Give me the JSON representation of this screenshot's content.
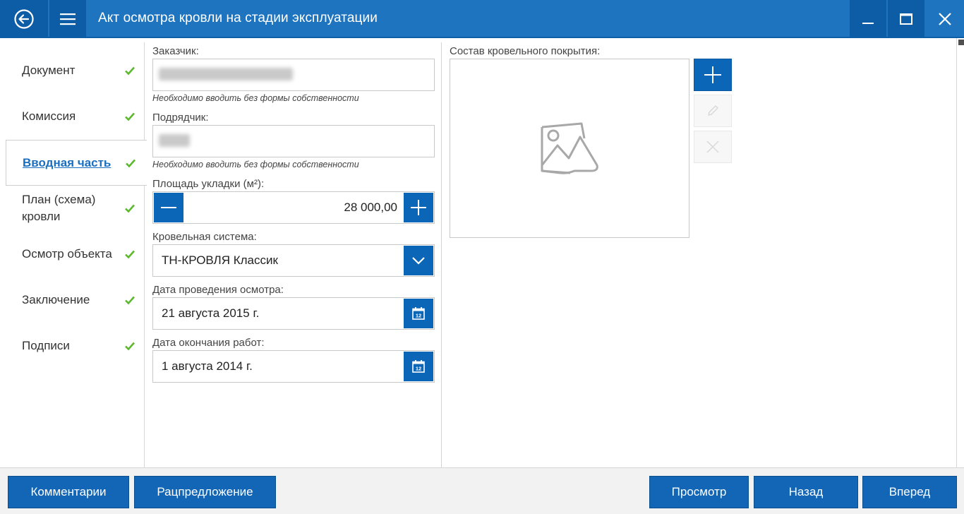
{
  "window": {
    "title": "Акт осмотра кровли на стадии эксплуатации"
  },
  "sidebar": {
    "items": [
      {
        "label": "Документ",
        "completed": true,
        "active": false
      },
      {
        "label": "Комиссия",
        "completed": true,
        "active": false
      },
      {
        "label": "Вводная часть",
        "completed": true,
        "active": true
      },
      {
        "label": "План (схема) кровли",
        "completed": true,
        "active": false
      },
      {
        "label": "Осмотр объекта",
        "completed": true,
        "active": false
      },
      {
        "label": "Заключение",
        "completed": true,
        "active": false
      },
      {
        "label": "Подписи",
        "completed": true,
        "active": false
      }
    ]
  },
  "form": {
    "customer": {
      "label": "Заказчик:",
      "hint": "Необходимо вводить без формы собственности"
    },
    "contractor": {
      "label": "Подрядчик:",
      "hint": "Необходимо вводить без формы собственности"
    },
    "area": {
      "label": "Площадь укладки (м²):",
      "value": "28 000,00"
    },
    "roof_system": {
      "label": "Кровельная система:",
      "value": "ТН-КРОВЛЯ Классик"
    },
    "inspection_date": {
      "label": "Дата проведения осмотра:",
      "value": "21 августа 2015 г."
    },
    "completion_date": {
      "label": "Дата окончания работ:",
      "value": "1 августа 2014 г."
    }
  },
  "roof_composition": {
    "label": "Состав кровельного покрытия:"
  },
  "bottom": {
    "comments": "Комментарии",
    "proposal": "Рацпредложение",
    "preview": "Просмотр",
    "back": "Назад",
    "forward": "Вперед"
  },
  "colors": {
    "titlebar": "#1e74bf",
    "accent": "#0c66b7",
    "check": "#5cb82e"
  },
  "icons": {
    "back": "arrow-left-circle-icon",
    "menu": "hamburger-icon",
    "minimize": "minimize-icon",
    "maximize": "maximize-icon",
    "close": "close-icon",
    "check": "checkmark-icon",
    "calendar": "calendar-icon",
    "image": "image-placeholder-icon",
    "add": "plus-icon",
    "edit": "pencil-icon",
    "delete": "x-icon"
  }
}
